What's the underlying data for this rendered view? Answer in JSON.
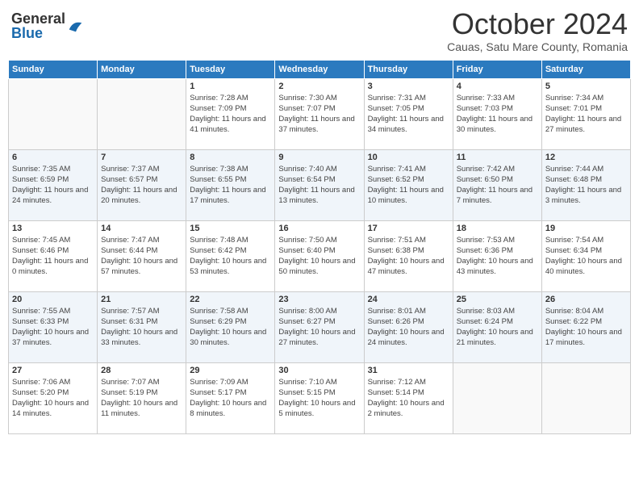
{
  "header": {
    "logo_general": "General",
    "logo_blue": "Blue",
    "month": "October 2024",
    "location": "Cauas, Satu Mare County, Romania"
  },
  "weekdays": [
    "Sunday",
    "Monday",
    "Tuesday",
    "Wednesday",
    "Thursday",
    "Friday",
    "Saturday"
  ],
  "weeks": [
    [
      {
        "day": "",
        "info": ""
      },
      {
        "day": "",
        "info": ""
      },
      {
        "day": "1",
        "info": "Sunrise: 7:28 AM\nSunset: 7:09 PM\nDaylight: 11 hours and 41 minutes."
      },
      {
        "day": "2",
        "info": "Sunrise: 7:30 AM\nSunset: 7:07 PM\nDaylight: 11 hours and 37 minutes."
      },
      {
        "day": "3",
        "info": "Sunrise: 7:31 AM\nSunset: 7:05 PM\nDaylight: 11 hours and 34 minutes."
      },
      {
        "day": "4",
        "info": "Sunrise: 7:33 AM\nSunset: 7:03 PM\nDaylight: 11 hours and 30 minutes."
      },
      {
        "day": "5",
        "info": "Sunrise: 7:34 AM\nSunset: 7:01 PM\nDaylight: 11 hours and 27 minutes."
      }
    ],
    [
      {
        "day": "6",
        "info": "Sunrise: 7:35 AM\nSunset: 6:59 PM\nDaylight: 11 hours and 24 minutes."
      },
      {
        "day": "7",
        "info": "Sunrise: 7:37 AM\nSunset: 6:57 PM\nDaylight: 11 hours and 20 minutes."
      },
      {
        "day": "8",
        "info": "Sunrise: 7:38 AM\nSunset: 6:55 PM\nDaylight: 11 hours and 17 minutes."
      },
      {
        "day": "9",
        "info": "Sunrise: 7:40 AM\nSunset: 6:54 PM\nDaylight: 11 hours and 13 minutes."
      },
      {
        "day": "10",
        "info": "Sunrise: 7:41 AM\nSunset: 6:52 PM\nDaylight: 11 hours and 10 minutes."
      },
      {
        "day": "11",
        "info": "Sunrise: 7:42 AM\nSunset: 6:50 PM\nDaylight: 11 hours and 7 minutes."
      },
      {
        "day": "12",
        "info": "Sunrise: 7:44 AM\nSunset: 6:48 PM\nDaylight: 11 hours and 3 minutes."
      }
    ],
    [
      {
        "day": "13",
        "info": "Sunrise: 7:45 AM\nSunset: 6:46 PM\nDaylight: 11 hours and 0 minutes."
      },
      {
        "day": "14",
        "info": "Sunrise: 7:47 AM\nSunset: 6:44 PM\nDaylight: 10 hours and 57 minutes."
      },
      {
        "day": "15",
        "info": "Sunrise: 7:48 AM\nSunset: 6:42 PM\nDaylight: 10 hours and 53 minutes."
      },
      {
        "day": "16",
        "info": "Sunrise: 7:50 AM\nSunset: 6:40 PM\nDaylight: 10 hours and 50 minutes."
      },
      {
        "day": "17",
        "info": "Sunrise: 7:51 AM\nSunset: 6:38 PM\nDaylight: 10 hours and 47 minutes."
      },
      {
        "day": "18",
        "info": "Sunrise: 7:53 AM\nSunset: 6:36 PM\nDaylight: 10 hours and 43 minutes."
      },
      {
        "day": "19",
        "info": "Sunrise: 7:54 AM\nSunset: 6:34 PM\nDaylight: 10 hours and 40 minutes."
      }
    ],
    [
      {
        "day": "20",
        "info": "Sunrise: 7:55 AM\nSunset: 6:33 PM\nDaylight: 10 hours and 37 minutes."
      },
      {
        "day": "21",
        "info": "Sunrise: 7:57 AM\nSunset: 6:31 PM\nDaylight: 10 hours and 33 minutes."
      },
      {
        "day": "22",
        "info": "Sunrise: 7:58 AM\nSunset: 6:29 PM\nDaylight: 10 hours and 30 minutes."
      },
      {
        "day": "23",
        "info": "Sunrise: 8:00 AM\nSunset: 6:27 PM\nDaylight: 10 hours and 27 minutes."
      },
      {
        "day": "24",
        "info": "Sunrise: 8:01 AM\nSunset: 6:26 PM\nDaylight: 10 hours and 24 minutes."
      },
      {
        "day": "25",
        "info": "Sunrise: 8:03 AM\nSunset: 6:24 PM\nDaylight: 10 hours and 21 minutes."
      },
      {
        "day": "26",
        "info": "Sunrise: 8:04 AM\nSunset: 6:22 PM\nDaylight: 10 hours and 17 minutes."
      }
    ],
    [
      {
        "day": "27",
        "info": "Sunrise: 7:06 AM\nSunset: 5:20 PM\nDaylight: 10 hours and 14 minutes."
      },
      {
        "day": "28",
        "info": "Sunrise: 7:07 AM\nSunset: 5:19 PM\nDaylight: 10 hours and 11 minutes."
      },
      {
        "day": "29",
        "info": "Sunrise: 7:09 AM\nSunset: 5:17 PM\nDaylight: 10 hours and 8 minutes."
      },
      {
        "day": "30",
        "info": "Sunrise: 7:10 AM\nSunset: 5:15 PM\nDaylight: 10 hours and 5 minutes."
      },
      {
        "day": "31",
        "info": "Sunrise: 7:12 AM\nSunset: 5:14 PM\nDaylight: 10 hours and 2 minutes."
      },
      {
        "day": "",
        "info": ""
      },
      {
        "day": "",
        "info": ""
      }
    ]
  ]
}
